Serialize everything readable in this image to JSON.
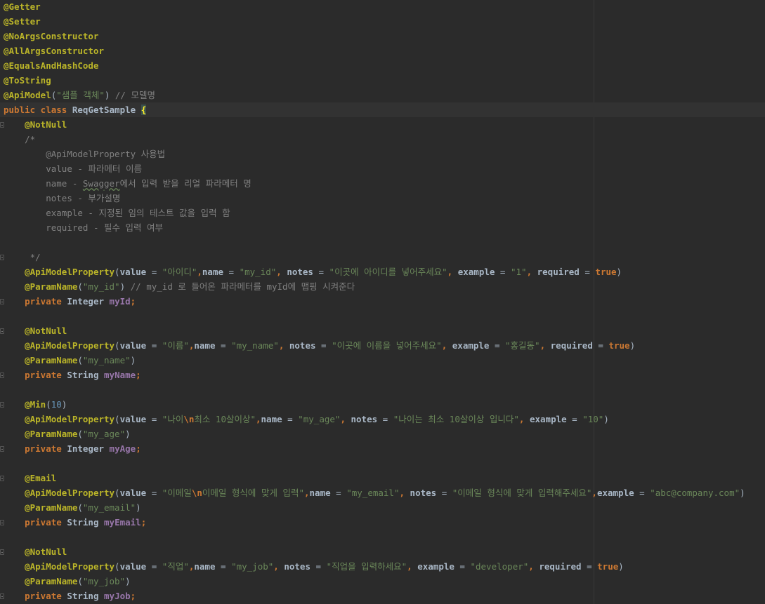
{
  "editor": {
    "lines": [
      {
        "indent": "",
        "tokens": [
          {
            "t": "@Getter",
            "c": "ann"
          }
        ]
      },
      {
        "indent": "",
        "tokens": [
          {
            "t": "@Setter",
            "c": "ann"
          }
        ]
      },
      {
        "indent": "",
        "tokens": [
          {
            "t": "@NoArgsConstructor",
            "c": "ann"
          }
        ]
      },
      {
        "indent": "",
        "tokens": [
          {
            "t": "@AllArgsConstructor",
            "c": "ann"
          }
        ]
      },
      {
        "indent": "",
        "tokens": [
          {
            "t": "@EqualsAndHashCode",
            "c": "ann"
          }
        ]
      },
      {
        "indent": "",
        "tokens": [
          {
            "t": "@ToString",
            "c": "ann"
          }
        ]
      },
      {
        "indent": "",
        "tokens": [
          {
            "t": "@ApiModel",
            "c": "ann"
          },
          {
            "t": "(",
            "c": ""
          },
          {
            "t": "\"샘플 객체\"",
            "c": "str"
          },
          {
            "t": ") ",
            "c": ""
          },
          {
            "t": "// 모델명",
            "c": "cmt"
          }
        ]
      },
      {
        "indent": "",
        "current": true,
        "tokens": [
          {
            "t": "public class ",
            "c": "kw"
          },
          {
            "t": "ReqGetSample ",
            "c": "typ"
          },
          {
            "t": "{",
            "c": "brace-hl"
          }
        ]
      },
      {
        "indent": "    ",
        "fold": true,
        "tokens": [
          {
            "t": "@NotNull",
            "c": "ann"
          }
        ]
      },
      {
        "indent": "    ",
        "tokens": [
          {
            "t": "/*",
            "c": "cmt"
          }
        ]
      },
      {
        "indent": "        ",
        "tokens": [
          {
            "t": "@ApiModelProperty 사용법",
            "c": "cmt"
          }
        ]
      },
      {
        "indent": "        ",
        "tokens": [
          {
            "t": "value - 파라메터 이름",
            "c": "cmt"
          }
        ]
      },
      {
        "indent": "        ",
        "tokens": [
          {
            "t": "name - ",
            "c": "cmt"
          },
          {
            "t": "Swagger",
            "c": "cmt squiggle"
          },
          {
            "t": "에서 입력 받을 리얼 파라메터 명",
            "c": "cmt"
          }
        ]
      },
      {
        "indent": "        ",
        "tokens": [
          {
            "t": "notes - 부가설명",
            "c": "cmt"
          }
        ]
      },
      {
        "indent": "        ",
        "tokens": [
          {
            "t": "example - 지정된 임의 테스트 값을 입력 함",
            "c": "cmt"
          }
        ]
      },
      {
        "indent": "        ",
        "tokens": [
          {
            "t": "required - 필수 입력 여부",
            "c": "cmt"
          }
        ]
      },
      {
        "indent": "",
        "tokens": []
      },
      {
        "indent": "     ",
        "fold": true,
        "tokens": [
          {
            "t": "*/",
            "c": "cmt"
          }
        ]
      },
      {
        "indent": "    ",
        "tokens": [
          {
            "t": "@ApiModelProperty",
            "c": "ann"
          },
          {
            "t": "(",
            "c": ""
          },
          {
            "t": "value",
            "c": "attr"
          },
          {
            "t": " = ",
            "c": ""
          },
          {
            "t": "\"아이디\"",
            "c": "str"
          },
          {
            "t": ",",
            "c": "kw"
          },
          {
            "t": "name",
            "c": "attr"
          },
          {
            "t": " = ",
            "c": ""
          },
          {
            "t": "\"my_id\"",
            "c": "str"
          },
          {
            "t": ", ",
            "c": "kw"
          },
          {
            "t": "notes",
            "c": "attr"
          },
          {
            "t": " = ",
            "c": ""
          },
          {
            "t": "\"이곳에 아이디를 넣어주세요\"",
            "c": "str"
          },
          {
            "t": ", ",
            "c": "kw"
          },
          {
            "t": "example",
            "c": "attr"
          },
          {
            "t": " = ",
            "c": ""
          },
          {
            "t": "\"1\"",
            "c": "str"
          },
          {
            "t": ", ",
            "c": "kw"
          },
          {
            "t": "required",
            "c": "attr"
          },
          {
            "t": " = ",
            "c": ""
          },
          {
            "t": "true",
            "c": "kw"
          },
          {
            "t": ")",
            "c": ""
          }
        ]
      },
      {
        "indent": "    ",
        "tokens": [
          {
            "t": "@ParamName",
            "c": "ann"
          },
          {
            "t": "(",
            "c": ""
          },
          {
            "t": "\"my_id\"",
            "c": "str"
          },
          {
            "t": ") ",
            "c": ""
          },
          {
            "t": "// my_id 로 들어온 파라메터를 myId에 맵핑 시켜준다",
            "c": "cmt"
          }
        ]
      },
      {
        "indent": "    ",
        "fold": true,
        "tokens": [
          {
            "t": "private ",
            "c": "kw"
          },
          {
            "t": "Integer ",
            "c": "typ"
          },
          {
            "t": "myId",
            "c": "fld"
          },
          {
            "t": ";",
            "c": "kw"
          }
        ]
      },
      {
        "indent": "",
        "tokens": []
      },
      {
        "indent": "    ",
        "fold": true,
        "tokens": [
          {
            "t": "@NotNull",
            "c": "ann"
          }
        ]
      },
      {
        "indent": "    ",
        "tokens": [
          {
            "t": "@ApiModelProperty",
            "c": "ann"
          },
          {
            "t": "(",
            "c": ""
          },
          {
            "t": "value",
            "c": "attr"
          },
          {
            "t": " = ",
            "c": ""
          },
          {
            "t": "\"이름\"",
            "c": "str"
          },
          {
            "t": ",",
            "c": "kw"
          },
          {
            "t": "name",
            "c": "attr"
          },
          {
            "t": " = ",
            "c": ""
          },
          {
            "t": "\"my_name\"",
            "c": "str"
          },
          {
            "t": ", ",
            "c": "kw"
          },
          {
            "t": "notes",
            "c": "attr"
          },
          {
            "t": " = ",
            "c": ""
          },
          {
            "t": "\"이곳에 이름을 넣어주세요\"",
            "c": "str"
          },
          {
            "t": ", ",
            "c": "kw"
          },
          {
            "t": "example",
            "c": "attr"
          },
          {
            "t": " = ",
            "c": ""
          },
          {
            "t": "\"홍길동\"",
            "c": "str"
          },
          {
            "t": ", ",
            "c": "kw"
          },
          {
            "t": "required",
            "c": "attr"
          },
          {
            "t": " = ",
            "c": ""
          },
          {
            "t": "true",
            "c": "kw"
          },
          {
            "t": ")",
            "c": ""
          }
        ]
      },
      {
        "indent": "    ",
        "tokens": [
          {
            "t": "@ParamName",
            "c": "ann"
          },
          {
            "t": "(",
            "c": ""
          },
          {
            "t": "\"my_name\"",
            "c": "str"
          },
          {
            "t": ")",
            "c": ""
          }
        ]
      },
      {
        "indent": "    ",
        "fold": true,
        "tokens": [
          {
            "t": "private ",
            "c": "kw"
          },
          {
            "t": "String ",
            "c": "typ"
          },
          {
            "t": "myName",
            "c": "fld"
          },
          {
            "t": ";",
            "c": "kw"
          }
        ]
      },
      {
        "indent": "",
        "tokens": []
      },
      {
        "indent": "    ",
        "fold": true,
        "tokens": [
          {
            "t": "@Min",
            "c": "ann"
          },
          {
            "t": "(",
            "c": ""
          },
          {
            "t": "10",
            "c": "num"
          },
          {
            "t": ")",
            "c": ""
          }
        ]
      },
      {
        "indent": "    ",
        "tokens": [
          {
            "t": "@ApiModelProperty",
            "c": "ann"
          },
          {
            "t": "(",
            "c": ""
          },
          {
            "t": "value",
            "c": "attr"
          },
          {
            "t": " = ",
            "c": ""
          },
          {
            "t": "\"나이",
            "c": "str"
          },
          {
            "t": "\\n",
            "c": "esc"
          },
          {
            "t": "최소 10살이상\"",
            "c": "str"
          },
          {
            "t": ",",
            "c": "kw"
          },
          {
            "t": "name",
            "c": "attr"
          },
          {
            "t": " = ",
            "c": ""
          },
          {
            "t": "\"my_age\"",
            "c": "str"
          },
          {
            "t": ", ",
            "c": "kw"
          },
          {
            "t": "notes",
            "c": "attr"
          },
          {
            "t": " = ",
            "c": ""
          },
          {
            "t": "\"나이는 최소 10살이상 입니다\"",
            "c": "str"
          },
          {
            "t": ", ",
            "c": "kw"
          },
          {
            "t": "example",
            "c": "attr"
          },
          {
            "t": " = ",
            "c": ""
          },
          {
            "t": "\"10\"",
            "c": "str"
          },
          {
            "t": ")",
            "c": ""
          }
        ]
      },
      {
        "indent": "    ",
        "tokens": [
          {
            "t": "@ParamName",
            "c": "ann"
          },
          {
            "t": "(",
            "c": ""
          },
          {
            "t": "\"my_age\"",
            "c": "str"
          },
          {
            "t": ")",
            "c": ""
          }
        ]
      },
      {
        "indent": "    ",
        "fold": true,
        "tokens": [
          {
            "t": "private ",
            "c": "kw"
          },
          {
            "t": "Integer ",
            "c": "typ"
          },
          {
            "t": "myAge",
            "c": "fld"
          },
          {
            "t": ";",
            "c": "kw"
          }
        ]
      },
      {
        "indent": "",
        "tokens": []
      },
      {
        "indent": "    ",
        "fold": true,
        "tokens": [
          {
            "t": "@Email",
            "c": "ann"
          }
        ]
      },
      {
        "indent": "    ",
        "tokens": [
          {
            "t": "@ApiModelProperty",
            "c": "ann"
          },
          {
            "t": "(",
            "c": ""
          },
          {
            "t": "value",
            "c": "attr"
          },
          {
            "t": " = ",
            "c": ""
          },
          {
            "t": "\"이메일",
            "c": "str"
          },
          {
            "t": "\\n",
            "c": "esc"
          },
          {
            "t": "이메일 형식에 맞게 입력\"",
            "c": "str"
          },
          {
            "t": ",",
            "c": "kw"
          },
          {
            "t": "name",
            "c": "attr"
          },
          {
            "t": " = ",
            "c": ""
          },
          {
            "t": "\"my_email\"",
            "c": "str"
          },
          {
            "t": ", ",
            "c": "kw"
          },
          {
            "t": "notes",
            "c": "attr"
          },
          {
            "t": " = ",
            "c": ""
          },
          {
            "t": "\"이메일 형식에 맞게 입력해주세요\"",
            "c": "str"
          },
          {
            "t": ",",
            "c": "kw"
          },
          {
            "t": "example",
            "c": "attr"
          },
          {
            "t": " = ",
            "c": ""
          },
          {
            "t": "\"abc@company.com\"",
            "c": "str"
          },
          {
            "t": ")",
            "c": ""
          }
        ]
      },
      {
        "indent": "    ",
        "tokens": [
          {
            "t": "@ParamName",
            "c": "ann"
          },
          {
            "t": "(",
            "c": ""
          },
          {
            "t": "\"my_email\"",
            "c": "str"
          },
          {
            "t": ")",
            "c": ""
          }
        ]
      },
      {
        "indent": "    ",
        "fold": true,
        "tokens": [
          {
            "t": "private ",
            "c": "kw"
          },
          {
            "t": "String ",
            "c": "typ"
          },
          {
            "t": "myEmail",
            "c": "fld"
          },
          {
            "t": ";",
            "c": "kw"
          }
        ]
      },
      {
        "indent": "",
        "tokens": []
      },
      {
        "indent": "    ",
        "fold": true,
        "tokens": [
          {
            "t": "@NotNull",
            "c": "ann"
          }
        ]
      },
      {
        "indent": "    ",
        "tokens": [
          {
            "t": "@ApiModelProperty",
            "c": "ann"
          },
          {
            "t": "(",
            "c": ""
          },
          {
            "t": "value",
            "c": "attr"
          },
          {
            "t": " = ",
            "c": ""
          },
          {
            "t": "\"직업\"",
            "c": "str"
          },
          {
            "t": ",",
            "c": "kw"
          },
          {
            "t": "name",
            "c": "attr"
          },
          {
            "t": " = ",
            "c": ""
          },
          {
            "t": "\"my_job\"",
            "c": "str"
          },
          {
            "t": ", ",
            "c": "kw"
          },
          {
            "t": "notes",
            "c": "attr"
          },
          {
            "t": " = ",
            "c": ""
          },
          {
            "t": "\"직업을 입력하세요\"",
            "c": "str"
          },
          {
            "t": ", ",
            "c": "kw"
          },
          {
            "t": "example",
            "c": "attr"
          },
          {
            "t": " = ",
            "c": ""
          },
          {
            "t": "\"developer\"",
            "c": "str"
          },
          {
            "t": ", ",
            "c": "kw"
          },
          {
            "t": "required",
            "c": "attr"
          },
          {
            "t": " = ",
            "c": ""
          },
          {
            "t": "true",
            "c": "kw"
          },
          {
            "t": ")",
            "c": ""
          }
        ]
      },
      {
        "indent": "    ",
        "tokens": [
          {
            "t": "@ParamName",
            "c": "ann"
          },
          {
            "t": "(",
            "c": ""
          },
          {
            "t": "\"my_job\"",
            "c": "str"
          },
          {
            "t": ")",
            "c": ""
          }
        ]
      },
      {
        "indent": "    ",
        "fold": true,
        "tokens": [
          {
            "t": "private ",
            "c": "kw"
          },
          {
            "t": "String ",
            "c": "typ"
          },
          {
            "t": "myJob",
            "c": "fld"
          },
          {
            "t": ";",
            "c": "kw"
          }
        ]
      }
    ]
  }
}
